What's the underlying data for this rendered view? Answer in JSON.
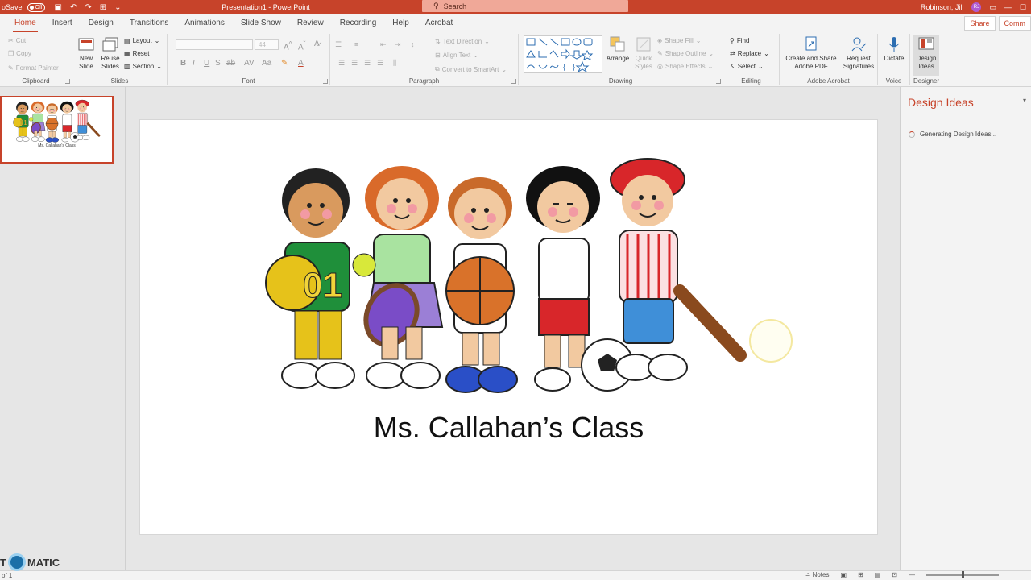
{
  "titlebar": {
    "autosave": "oSave",
    "toggle": "Off",
    "doc_title": "Presentation1 - PowerPoint",
    "search": "Search",
    "user": "Robinson, Jill",
    "initials": "RJ"
  },
  "tabs": [
    "Home",
    "Insert",
    "Design",
    "Transitions",
    "Animations",
    "Slide Show",
    "Review",
    "Recording",
    "Help",
    "Acrobat"
  ],
  "tabrow_right": {
    "share": "Share",
    "comments": "Comm"
  },
  "ribbon": {
    "clipboard": {
      "cut": "Cut",
      "copy": "Copy",
      "format_painter": "Format Painter",
      "label": "Clipboard"
    },
    "slides": {
      "new_slide": "New Slide",
      "reuse_slides": "Reuse Slides",
      "layout": "Layout",
      "reset": "Reset",
      "section": "Section",
      "label": "Slides"
    },
    "font": {
      "size": "44",
      "label": "Font"
    },
    "paragraph": {
      "text_direction": "Text Direction",
      "align_text": "Align Text",
      "convert_smartart": "Convert to SmartArt",
      "label": "Paragraph"
    },
    "drawing": {
      "arrange": "Arrange",
      "quick_styles": "Quick Styles",
      "shape_fill": "Shape Fill",
      "shape_outline": "Shape Outline",
      "shape_effects": "Shape Effects",
      "label": "Drawing"
    },
    "editing": {
      "find": "Find",
      "replace": "Replace",
      "select": "Select",
      "label": "Editing"
    },
    "acrobat": {
      "create_share": "Create and Share Adobe PDF",
      "request_signatures": "Request Signatures",
      "label": "Adobe Acrobat"
    },
    "voice": {
      "dictate": "Dictate",
      "label": "Voice"
    },
    "designer": {
      "design_ideas": "Design Ideas",
      "label": "Designer"
    }
  },
  "thumbnail": {
    "title": "Ms. Callahan's Class"
  },
  "slide": {
    "title": "Ms. Callahan’s Class"
  },
  "design_pane": {
    "title": "Design Ideas",
    "status": "Generating Design Ideas..."
  },
  "statusbar": {
    "slide_of": "of 1",
    "notes": "Notes"
  },
  "watermark": {
    "left": "T",
    "right": "MATIC"
  },
  "colors": {
    "accent": "#c7432a",
    "panel": "#f3f3f3",
    "workspace": "#e6e6e6"
  }
}
